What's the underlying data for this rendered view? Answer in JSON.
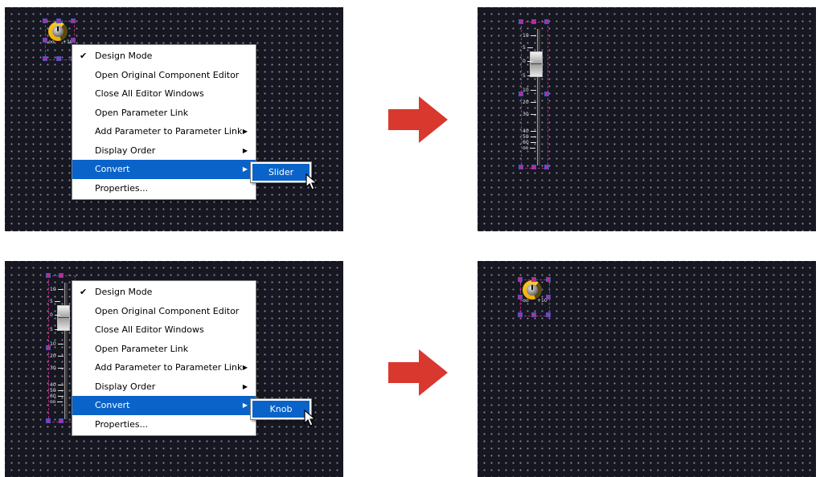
{
  "panels": {
    "knob": {
      "min_label": "-oo",
      "max_label": "+10"
    },
    "slider": {
      "tick_labels": [
        "10",
        "5",
        "0",
        "5",
        "10",
        "20",
        "30",
        "40",
        "50",
        "60",
        "oo"
      ]
    }
  },
  "context_menu": {
    "items": [
      {
        "label": "Design Mode",
        "checked": true
      },
      {
        "label": "Open Original Component Editor"
      },
      {
        "label": "Close All Editor Windows"
      },
      {
        "label": "Open Parameter Link"
      },
      {
        "label": "Add Parameter to Parameter Link",
        "has_submenu": true
      },
      {
        "label": "Display Order",
        "has_submenu": true
      },
      {
        "label": "Convert",
        "has_submenu": true,
        "highlighted": true
      },
      {
        "label": "Properties..."
      }
    ],
    "submenu_top": "Slider",
    "submenu_bottom": "Knob",
    "highlight_color": "#0a63c9"
  },
  "colors": {
    "canvas": "#171722",
    "arrow": "#d8382e",
    "knob_ring": "#f2b300",
    "selection": "#c02a8c"
  }
}
